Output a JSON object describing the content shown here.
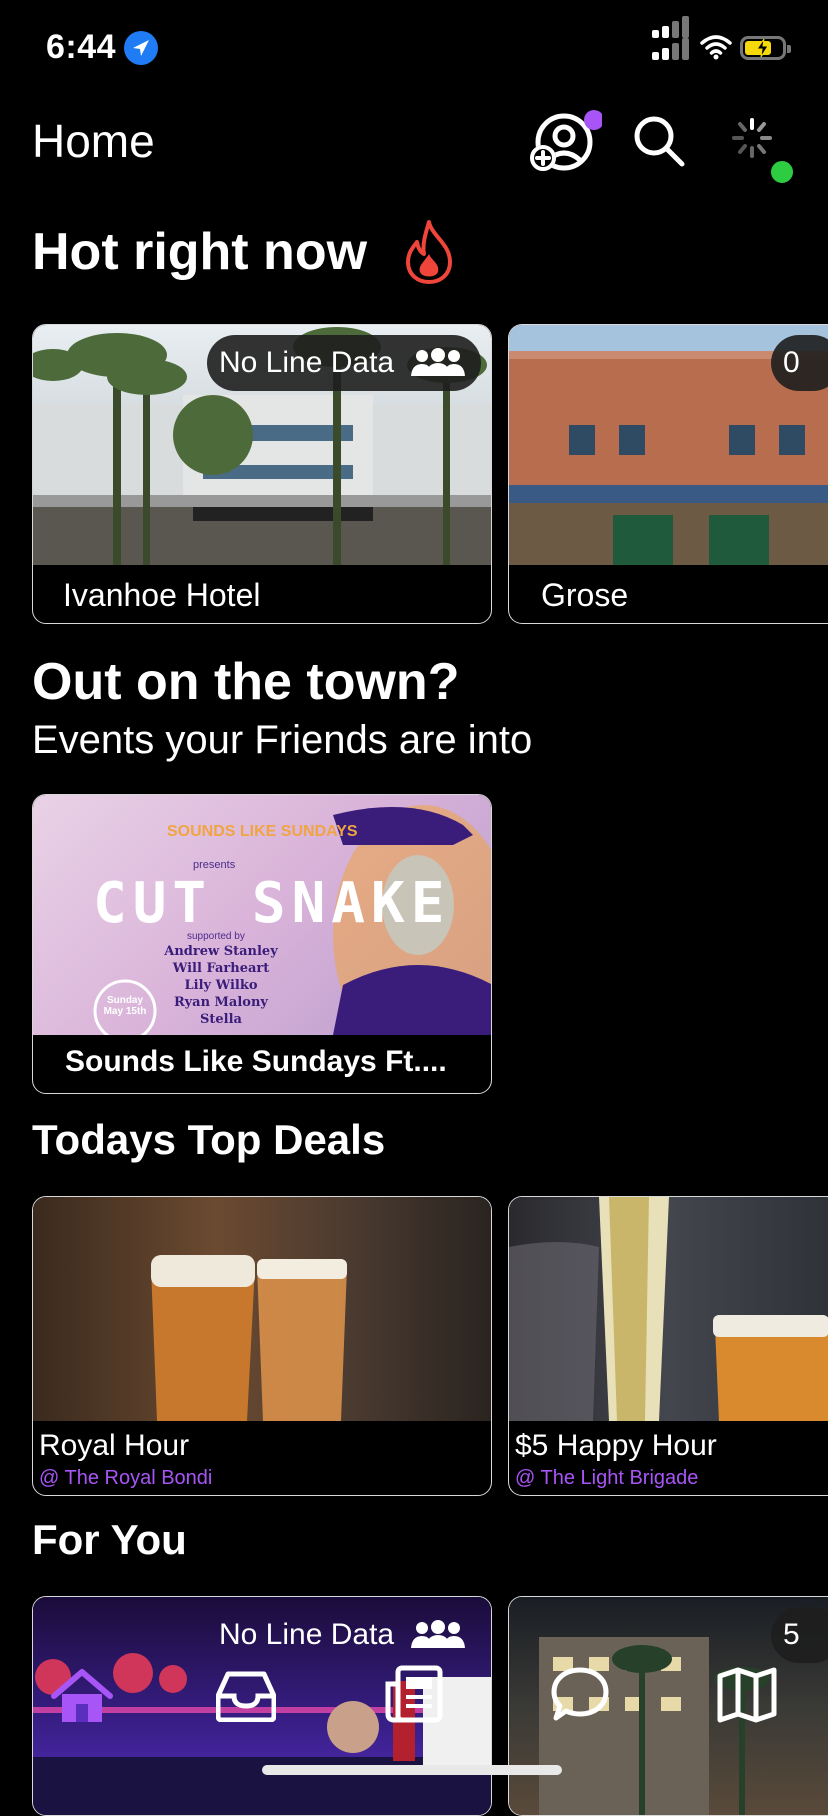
{
  "status_bar": {
    "time": "6:44"
  },
  "header": {
    "title": "Home"
  },
  "hot_section": {
    "title": "Hot right now",
    "cards": [
      {
        "name": "Ivanhoe Hotel",
        "badge": "No Line Data"
      },
      {
        "name": "Grose",
        "badge": "0"
      }
    ]
  },
  "events_section": {
    "title": "Out on the town?",
    "subtitle": "Events your Friends are into",
    "cards": [
      {
        "name": "Sounds Like Sundays Ft....",
        "poster": {
          "brand": "SOUNDS LIKE SUNDAYS",
          "presents": "presents",
          "headline": "CUT SNAKE",
          "supported_by": "supported by",
          "lineup": [
            "Andrew Stanley",
            "Will Farheart",
            "Lily Wilko",
            "Ryan Malony",
            "Stella"
          ],
          "date": "Sunday May 15th"
        }
      }
    ]
  },
  "deals_section": {
    "title": "Todays Top Deals",
    "cards": [
      {
        "name": "Royal Hour",
        "venue": "@ The Royal Bondi"
      },
      {
        "name": "$5 Happy Hour",
        "venue": "@ The Light Brigade"
      }
    ]
  },
  "for_you_section": {
    "title": "For You",
    "cards": [
      {
        "badge": "No Line Data"
      },
      {
        "badge": "5"
      }
    ]
  },
  "tab_bar": {
    "items": [
      "home-icon",
      "inbox-icon",
      "news-icon",
      "chat-icon",
      "map-icon"
    ],
    "active_color": "#a855f7"
  },
  "colors": {
    "accent": "#a855f7",
    "online": "#2ecc40",
    "fire": "#f0453a"
  }
}
